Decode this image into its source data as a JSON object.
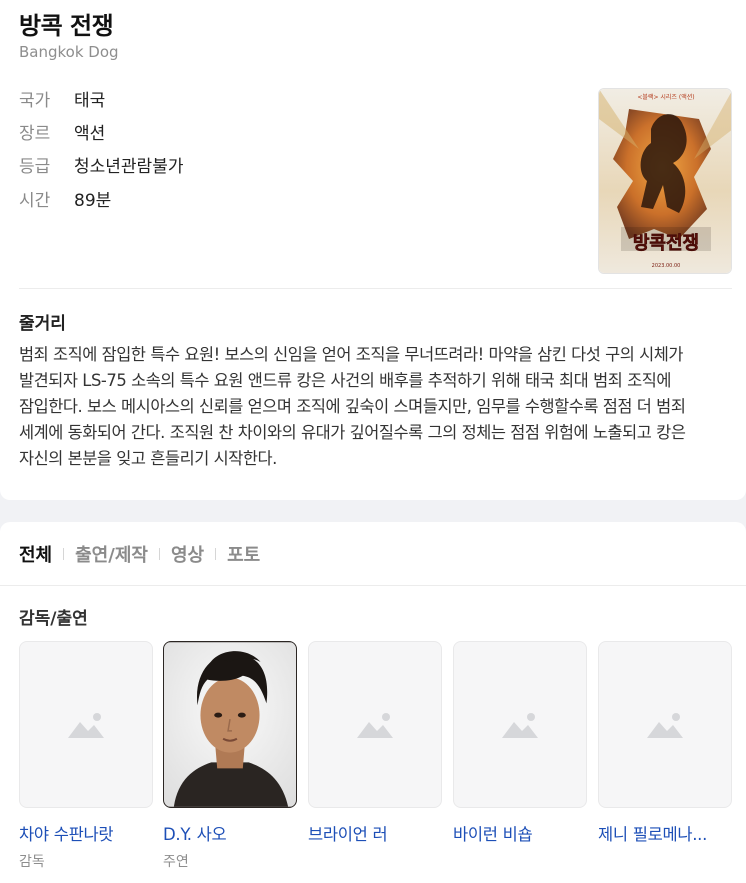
{
  "movie": {
    "title": "방콕 전쟁",
    "original_title": "Bangkok Dog",
    "info": [
      {
        "label": "국가",
        "value": "태국"
      },
      {
        "label": "장르",
        "value": "액션"
      },
      {
        "label": "등급",
        "value": "청소년관람불가"
      },
      {
        "label": "시간",
        "value": "89분"
      }
    ],
    "poster": {
      "top_caption": "<블랙> 시리즈 (액션)",
      "title_text": "방콕전쟁",
      "date_text": "2023.00.00"
    }
  },
  "synopsis": {
    "heading": "줄거리",
    "text": "범죄 조직에 잠입한 특수 요원! 보스의 신임을 얻어 조직을 무너뜨려라! 마약을 삼킨 다섯 구의 시체가 발견되자 LS-75 소속의 특수 요원 앤드류 캉은 사건의 배후를 추적하기 위해 태국 최대 범죄 조직에 잠입한다. 보스 메시아스의 신뢰를 얻으며 조직에 깊숙이 스며들지만, 임무를 수행할수록 점점 더 범죄 세계에 동화되어 간다. 조직원 찬 차이와의 유대가 깊어질수록 그의 정체는 점점 위험에 노출되고 캉은 자신의 본분을 잊고 흔들리기 시작한다."
  },
  "tabs": [
    "전체",
    "출연/제작",
    "영상",
    "포토"
  ],
  "active_tab": "전체",
  "cast_section": {
    "heading": "감독/출연",
    "people": [
      {
        "name": "차야 수판나랏",
        "role": "감독",
        "has_photo": false
      },
      {
        "name": "D.Y. 사오",
        "role": "주연",
        "has_photo": true
      },
      {
        "name": "브라이언 러",
        "role": "",
        "has_photo": false
      },
      {
        "name": "바이런 비숍",
        "role": "",
        "has_photo": false
      },
      {
        "name": "제니 필로메나...",
        "role": "",
        "has_photo": false
      }
    ]
  },
  "icons": {
    "placeholder": "image-placeholder-icon"
  },
  "colors": {
    "link": "#1d4fb7",
    "muted": "#8e8e8e",
    "bg": "#f1f2f5"
  }
}
